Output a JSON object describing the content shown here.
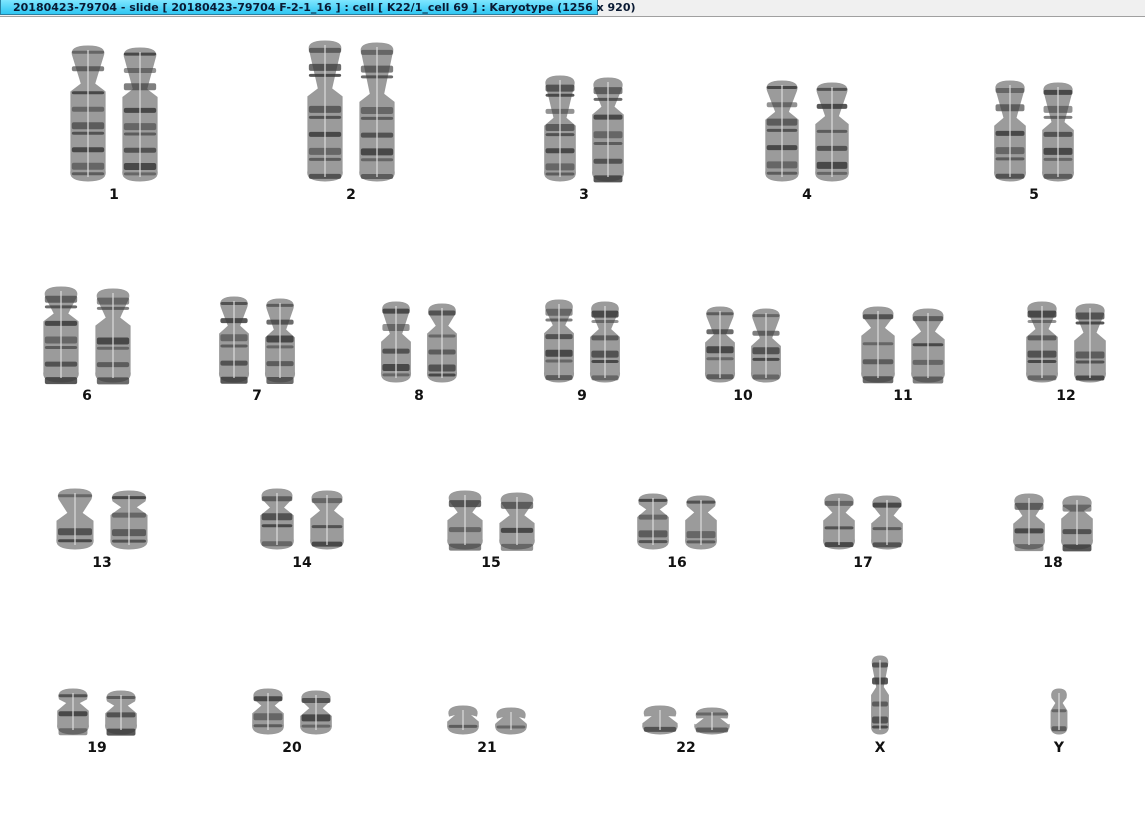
{
  "window": {
    "title": "20180423-79704 - slide [ 20180423-79704 F-2-1_16 ] : cell [ K22/1_cell 69 ] : Karyotype  (1256 x 920)"
  },
  "karyotype": {
    "chromosomes": [
      {
        "label": "1"
      },
      {
        "label": "2"
      },
      {
        "label": "3"
      },
      {
        "label": "4"
      },
      {
        "label": "5"
      },
      {
        "label": "6"
      },
      {
        "label": "7"
      },
      {
        "label": "8"
      },
      {
        "label": "9"
      },
      {
        "label": "10"
      },
      {
        "label": "11"
      },
      {
        "label": "12"
      },
      {
        "label": "13"
      },
      {
        "label": "14"
      },
      {
        "label": "15"
      },
      {
        "label": "16"
      },
      {
        "label": "17"
      },
      {
        "label": "18"
      },
      {
        "label": "19"
      },
      {
        "label": "20"
      },
      {
        "label": "21"
      },
      {
        "label": "22"
      },
      {
        "label": "X"
      },
      {
        "label": "Y"
      }
    ]
  },
  "colors": {
    "tab_start": "#7fe6ff",
    "tab_end": "#2fc6f2",
    "chromosome": "#3a3a3a"
  }
}
